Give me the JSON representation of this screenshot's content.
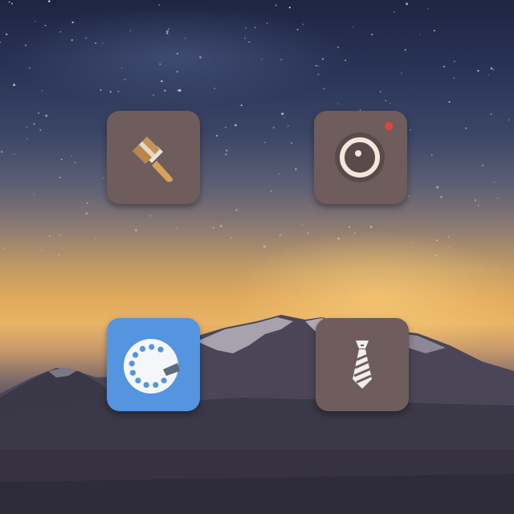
{
  "wallpaper": {
    "description_colors": {
      "sky_top": "#1d2542",
      "horizon_glow": "#e8b466",
      "mountain": "#3d3a49",
      "snow": "#c9c3cc"
    }
  },
  "apps": [
    {
      "icon": "paint-brush-icon",
      "tile_color": "#6e5d5c"
    },
    {
      "icon": "camera-icon",
      "tile_color": "#6e5d5c",
      "accent": "#e0453a"
    },
    {
      "icon": "rotary-dial-icon",
      "tile_color": "#5594de"
    },
    {
      "icon": "necktie-icon",
      "tile_color": "#6e5d5c"
    }
  ]
}
